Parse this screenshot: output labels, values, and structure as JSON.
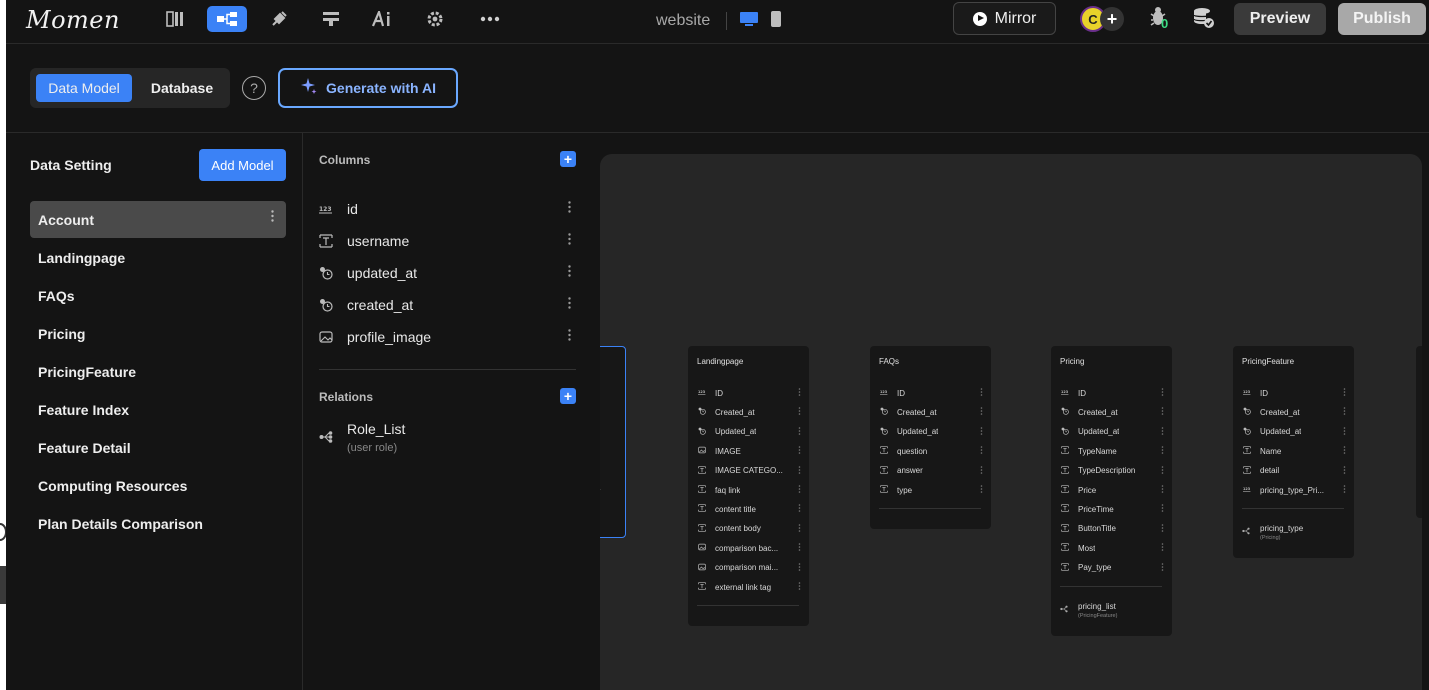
{
  "app": {
    "logo": "Momen",
    "project_name": "website"
  },
  "topbar": {
    "mirror_label": "Mirror",
    "avatar_initial": "C",
    "avatar_add": "+",
    "debug_count": "0",
    "preview_label": "Preview",
    "publish_label": "Publish"
  },
  "subbar": {
    "tab_data_model": "Data Model",
    "tab_database": "Database",
    "help": "?",
    "generate_label": "Generate with AI"
  },
  "left": {
    "title": "Data Setting",
    "add_model": "Add Model",
    "models": [
      "Account",
      "Landingpage",
      "FAQs",
      "Pricing",
      "PricingFeature",
      "Feature Index",
      "Feature Detail",
      "Computing Resources",
      "Plan Details Comparison"
    ],
    "selected_index": 0
  },
  "columns": {
    "header": "Columns",
    "items": [
      {
        "name": "id",
        "type": "number"
      },
      {
        "name": "username",
        "type": "text"
      },
      {
        "name": "updated_at",
        "type": "datetime"
      },
      {
        "name": "created_at",
        "type": "datetime"
      },
      {
        "name": "profile_image",
        "type": "image"
      }
    ]
  },
  "relations": {
    "header": "Relations",
    "items": [
      {
        "name": "Role_List",
        "target": "(user role)"
      }
    ]
  },
  "cards": [
    {
      "title": "Landingpage",
      "rows": [
        {
          "name": "ID",
          "type": "number"
        },
        {
          "name": "Created_at",
          "type": "datetime"
        },
        {
          "name": "Updated_at",
          "type": "datetime"
        },
        {
          "name": "IMAGE",
          "type": "image"
        },
        {
          "name": "IMAGE CATEGO...",
          "type": "text"
        },
        {
          "name": "faq link",
          "type": "text"
        },
        {
          "name": "content title",
          "type": "text"
        },
        {
          "name": "content body",
          "type": "text"
        },
        {
          "name": "comparison bac...",
          "type": "image"
        },
        {
          "name": "comparison mai...",
          "type": "image"
        },
        {
          "name": "external link tag",
          "type": "text"
        }
      ],
      "relations": []
    },
    {
      "title": "FAQs",
      "rows": [
        {
          "name": "ID",
          "type": "number"
        },
        {
          "name": "Created_at",
          "type": "datetime"
        },
        {
          "name": "Updated_at",
          "type": "datetime"
        },
        {
          "name": "question",
          "type": "text"
        },
        {
          "name": "answer",
          "type": "text"
        },
        {
          "name": "type",
          "type": "text"
        }
      ],
      "relations": []
    },
    {
      "title": "Pricing",
      "rows": [
        {
          "name": "ID",
          "type": "number"
        },
        {
          "name": "Created_at",
          "type": "datetime"
        },
        {
          "name": "Updated_at",
          "type": "datetime"
        },
        {
          "name": "TypeName",
          "type": "text"
        },
        {
          "name": "TypeDescription",
          "type": "text"
        },
        {
          "name": "Price",
          "type": "text"
        },
        {
          "name": "PriceTime",
          "type": "text"
        },
        {
          "name": "ButtonTitle",
          "type": "text"
        },
        {
          "name": "Most",
          "type": "text"
        },
        {
          "name": "Pay_type",
          "type": "text"
        }
      ],
      "relations": [
        {
          "name": "pricing_list",
          "target": "(PricingFeature)"
        }
      ]
    },
    {
      "title": "PricingFeature",
      "rows": [
        {
          "name": "ID",
          "type": "number"
        },
        {
          "name": "Created_at",
          "type": "datetime"
        },
        {
          "name": "Updated_at",
          "type": "datetime"
        },
        {
          "name": "Name",
          "type": "text"
        },
        {
          "name": "detail",
          "type": "text"
        },
        {
          "name": "pricing_type_Pri...",
          "type": "number"
        }
      ],
      "relations": [
        {
          "name": "pricing_type",
          "target": "(Pricing)"
        }
      ]
    }
  ],
  "colors": {
    "accent": "#3b82f6",
    "bg": "#141414",
    "canvas": "#262626",
    "card": "#171717"
  }
}
